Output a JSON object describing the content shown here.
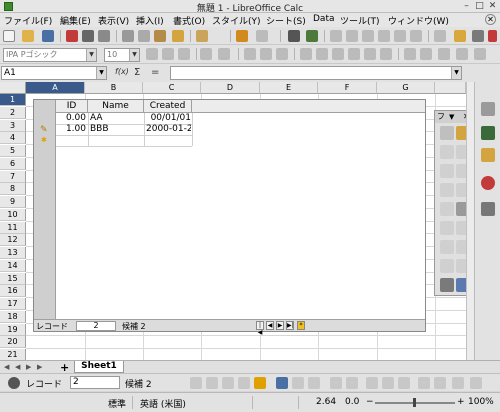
{
  "window": {
    "title": "無題 1 - LibreOffice Calc",
    "minimize_glyph": "–",
    "maximize_glyph": "□",
    "close_glyph": "✕"
  },
  "menubar": {
    "items": [
      "ファイル(F)",
      "編集(E)",
      "表示(V)",
      "挿入(I)",
      "書式(O)",
      "スタイル(Y)",
      "シート(S)",
      "Data",
      "ツール(T)",
      "ウィンドウ(W)"
    ],
    "close_doc_glyph": "✕"
  },
  "formatting": {
    "font_name": "IPA Pゴシック",
    "font_size": "10"
  },
  "formula_bar": {
    "cell_ref": "A1",
    "formula": "",
    "function_wizard": "f(x)",
    "sum_glyph": "Σ",
    "equal_glyph": "="
  },
  "sheet": {
    "columns": [
      "A",
      "B",
      "C",
      "D",
      "E",
      "F",
      "G"
    ],
    "rows": [
      "1",
      "2",
      "3",
      "4",
      "5",
      "6",
      "7",
      "8",
      "9",
      "10",
      "11",
      "12",
      "13",
      "14",
      "15",
      "16",
      "17",
      "18",
      "19",
      "20",
      "21"
    ],
    "active_column": "A",
    "active_row": "1"
  },
  "table_control": {
    "headers": [
      "ID",
      "Name",
      "Created"
    ],
    "records": [
      [
        "0.00",
        "AA",
        "00/01/01"
      ],
      [
        "1.00",
        "BBB",
        "2000-01-2"
      ]
    ],
    "nav": {
      "record_label": "レコード",
      "record_value": "2",
      "of_label": "候補 2"
    }
  },
  "form_design_toolbar": {
    "title": "フ",
    "menu_glyph": "▼",
    "close_glyph": "✕"
  },
  "tabs": {
    "nav_glyphs": [
      "◀",
      "◀",
      "▶",
      "▶"
    ],
    "add_glyph": "+",
    "sheets": [
      "Sheet1"
    ]
  },
  "form_navigation": {
    "record_label": "レコード",
    "record_value": "2",
    "of_label": "候補 2"
  },
  "status": {
    "page_style": "標準",
    "language": "英語 (米国)",
    "sum_a": "2.64",
    "sum_b": "0.0",
    "zoom": "100%",
    "zoom_minus": "−",
    "zoom_plus": "+"
  }
}
